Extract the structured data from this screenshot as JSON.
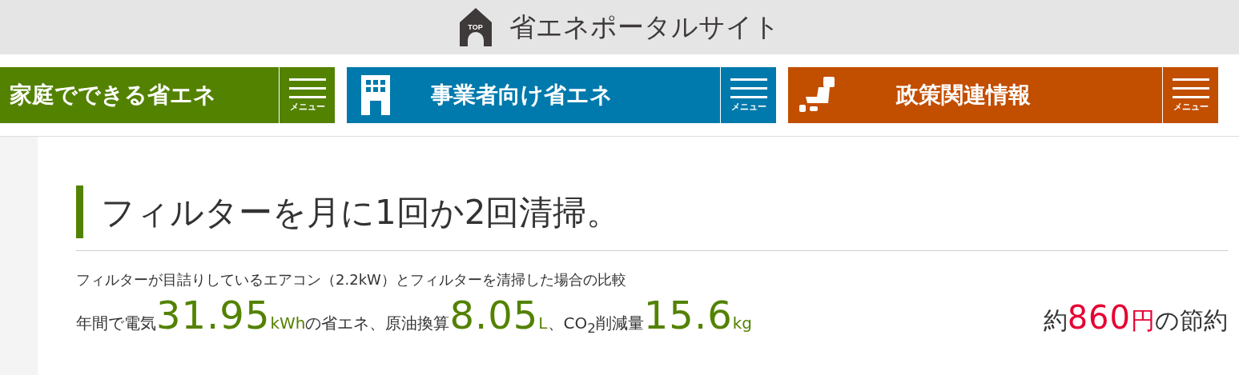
{
  "header": {
    "top_label": "TOP",
    "title": "省エネポータルサイト"
  },
  "nav": [
    {
      "label": "家庭でできる省エネ",
      "kind": "home",
      "color": "#538200",
      "menu_label": "メニュー"
    },
    {
      "label": "事業者向け省エネ",
      "kind": "building",
      "color": "#0079ac",
      "menu_label": "メニュー"
    },
    {
      "label": "政策関連情報",
      "kind": "map",
      "color": "#c24e00",
      "menu_label": "メニュー"
    }
  ],
  "article": {
    "title": "フィルターを月に1回か2回清掃。",
    "subtitle": "フィルターが目詰りしているエアコン（2.2kW）とフィルターを清掃した場合の比較",
    "savings": [
      {
        "kind": "label",
        "text": "年間で電気"
      },
      {
        "kind": "value",
        "text": "31.95"
      },
      {
        "kind": "unit",
        "text": "kWh"
      },
      {
        "kind": "label",
        "text": "の省エネ、原油換算"
      },
      {
        "kind": "value",
        "text": "8.05"
      },
      {
        "kind": "unit",
        "text": "L"
      },
      {
        "kind": "label",
        "text": "、CO$_{2}$削減量"
      },
      {
        "kind": "value",
        "text": "15.6"
      },
      {
        "kind": "unit",
        "text": "kg"
      }
    ],
    "price": [
      {
        "kind": "label",
        "text": "約"
      },
      {
        "kind": "value",
        "text": "860"
      },
      {
        "kind": "unit",
        "text": "円"
      },
      {
        "kind": "label",
        "text": "の節約"
      }
    ]
  }
}
